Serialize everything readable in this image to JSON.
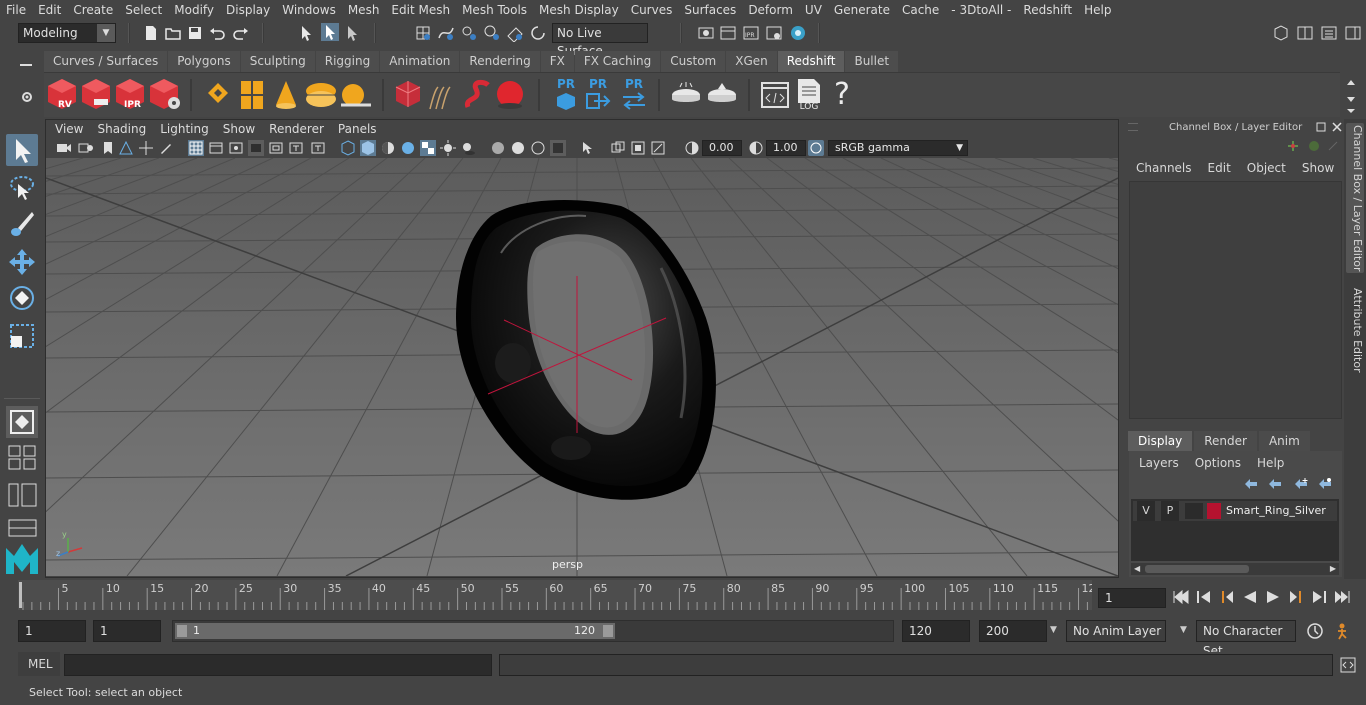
{
  "menubar": {
    "items": [
      "File",
      "Edit",
      "Create",
      "Select",
      "Modify",
      "Display",
      "Windows",
      "Mesh",
      "Edit Mesh",
      "Mesh Tools",
      "Mesh Display",
      "Curves",
      "Surfaces",
      "Deform",
      "UV",
      "Generate",
      "Cache",
      "- 3DtoAll -",
      "Redshift",
      "Help"
    ]
  },
  "statusline": {
    "mode": "Modeling",
    "live_surface": "No Live Surface"
  },
  "shelf": {
    "tabs": [
      "Curves / Surfaces",
      "Polygons",
      "Sculpting",
      "Rigging",
      "Animation",
      "Rendering",
      "FX",
      "FX Caching",
      "Custom",
      "XGen",
      "Redshift",
      "Bullet"
    ],
    "active_tab": "Redshift",
    "icon_labels": {
      "rv": "RV",
      "ipr": "IPR",
      "pr": "PR",
      "log": "LOG",
      "help": "?"
    }
  },
  "viewport": {
    "menu": [
      "View",
      "Shading",
      "Lighting",
      "Show",
      "Renderer",
      "Panels"
    ],
    "exposure": "0.00",
    "gamma": "1.00",
    "color_space": "sRGB gamma",
    "camera_label": "persp"
  },
  "channel_box": {
    "title": "Channel Box / Layer Editor",
    "menu": [
      "Channels",
      "Edit",
      "Object",
      "Show"
    ],
    "layer_tabs": [
      "Display",
      "Render",
      "Anim"
    ],
    "active_layer_tab": "Display",
    "layer_menu": [
      "Layers",
      "Options",
      "Help"
    ],
    "layers": [
      {
        "v": "V",
        "p": "P",
        "color": "#b5122f",
        "name": "Smart_Ring_Silver"
      }
    ]
  },
  "side_tabs": [
    "Channel Box / Layer Editor",
    "Attribute Editor"
  ],
  "timeline": {
    "ticks": [
      "5",
      "10",
      "15",
      "20",
      "25",
      "30",
      "35",
      "40",
      "45",
      "50",
      "55",
      "60",
      "65",
      "70",
      "75",
      "80",
      "85",
      "90",
      "95",
      "100",
      "105",
      "110",
      "115",
      "12"
    ],
    "start_marker": "1",
    "current_frame": "1"
  },
  "range": {
    "start": "1",
    "playback_start": "1",
    "slider_start": "1",
    "slider_end": "120",
    "playback_end": "120",
    "end": "200",
    "anim_layer": "No Anim Layer",
    "character_set": "No Character Set"
  },
  "cmdline": {
    "label": "MEL"
  },
  "helpline": {
    "text": "Select Tool: select an object"
  },
  "colors": {
    "accent": "#5d7b93",
    "layer_color": "#b5122f",
    "viewport_bg": "#6d6d6d"
  }
}
